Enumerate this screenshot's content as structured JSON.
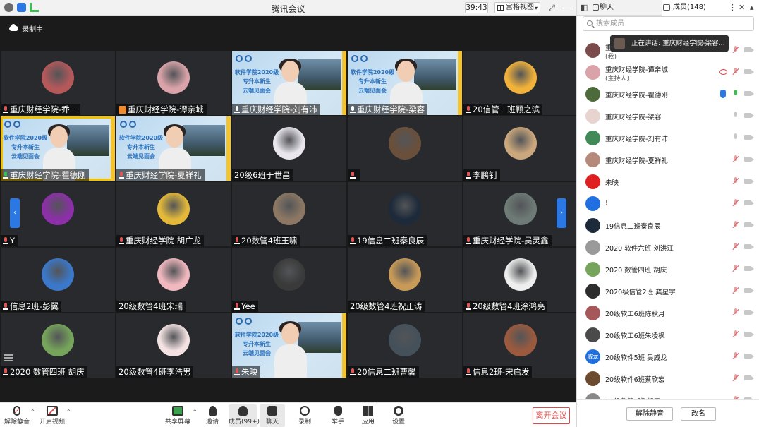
{
  "window": {
    "title": "腾讯会议",
    "timer": "39:43",
    "view_mode": "宫格视图"
  },
  "recording": {
    "label": "录制中"
  },
  "tiles": [
    {
      "name": "重庆财经学院-乔一",
      "mic": "muted",
      "kind": "avatar",
      "color": "#b4585a"
    },
    {
      "name": "重庆财经学院-谭亲城",
      "mic": "user",
      "kind": "avatar",
      "color": "#d9a3a9"
    },
    {
      "name": "重庆财经学院-刘有沛",
      "mic": "on",
      "kind": "slide",
      "active": false
    },
    {
      "name": "重庆财经学院-梁容",
      "mic": "on",
      "kind": "slide",
      "active": false
    },
    {
      "name": "20信管二班顾之滨",
      "mic": "muted",
      "kind": "avatar",
      "color": "#f1b23a"
    },
    {
      "name": "重庆财经学院-瞿德刚",
      "mic": "green",
      "kind": "slide",
      "active": true
    },
    {
      "name": "重庆财经学院-夏祥礼",
      "mic": "muted",
      "kind": "slide",
      "active": false
    },
    {
      "name": "20级6班于世昌",
      "mic": "none",
      "kind": "avatar",
      "color": "#e9e6ee"
    },
    {
      "name": "",
      "mic": "muted",
      "kind": "avatar",
      "color": "#6a4f3a"
    },
    {
      "name": "李鹏钊",
      "mic": "muted",
      "kind": "avatar",
      "color": "#caa77c"
    },
    {
      "name": "Y",
      "mic": "muted",
      "kind": "avatar",
      "color": "#8c2fa8"
    },
    {
      "name": "重庆财经学院 胡广龙",
      "mic": "muted",
      "kind": "avatar",
      "color": "#e4b93a"
    },
    {
      "name": "20数管4班王啸",
      "mic": "muted",
      "kind": "avatar",
      "color": "#8b7763"
    },
    {
      "name": "19信息二班秦良辰",
      "mic": "muted",
      "kind": "avatar",
      "color": "#1d2a3a"
    },
    {
      "name": "重庆财经学院-吴灵鑫",
      "mic": "muted",
      "kind": "avatar",
      "color": "#6d7a75"
    },
    {
      "name": "信息2班-彭翼",
      "mic": "muted",
      "kind": "avatar",
      "color": "#3b78c9"
    },
    {
      "name": "20级数管4班宋瑞",
      "mic": "none",
      "kind": "avatar",
      "color": "#f1b9bf"
    },
    {
      "name": "Yee",
      "mic": "muted",
      "kind": "avatar",
      "color": "#3a3a3a"
    },
    {
      "name": "20级数管4班祝正涛",
      "mic": "none",
      "kind": "avatar",
      "color": "#c89a58"
    },
    {
      "name": "20级数管4班涂鸿亮",
      "mic": "muted",
      "kind": "avatar",
      "color": "#eeeeee"
    },
    {
      "name": "2020 数管四班 胡庆",
      "mic": "muted",
      "kind": "avatar",
      "color": "#76a45a"
    },
    {
      "name": "20级数管4班李浩男",
      "mic": "none",
      "kind": "avatar",
      "color": "#f4e2e3"
    },
    {
      "name": "朱映",
      "mic": "muted",
      "kind": "slide",
      "active": false
    },
    {
      "name": "20信息二班曹馨",
      "mic": "muted",
      "kind": "avatar",
      "color": "#44505a"
    },
    {
      "name": "信息2班-宋启发",
      "mic": "muted",
      "kind": "avatar",
      "color": "#9b5a3e"
    }
  ],
  "slide": {
    "line1": "软件学院2020级",
    "line2": "专升本新生",
    "line3": "云端见面会"
  },
  "toolbar": {
    "unmute": "解除静音",
    "video": "开启视频",
    "share": "共享屏幕",
    "invite": "邀请",
    "members": "成员(99+)",
    "chat": "聊天",
    "record": "录制",
    "hand": "举手",
    "apps": "应用",
    "settings": "设置",
    "leave": "离开会议"
  },
  "panel": {
    "tab_chat": "聊天",
    "tab_members": "成员(148)",
    "search_placeholder": "搜索成员",
    "speaking": "正在讲话: 重庆财经学院-梁容...",
    "unmute_all": "解除静音",
    "rename": "改名",
    "members": [
      {
        "name": "重",
        "sub": "(我)",
        "mic": "muted",
        "color": "#7b4b4b"
      },
      {
        "name": "重庆财经学院-谭亲城",
        "sub": "(主持人)",
        "mic": "muted",
        "rec": true,
        "color": "#d9a3a9"
      },
      {
        "name": "重庆财经学院-瞿德刚",
        "sub": "",
        "mic": "active",
        "hand": true,
        "color": "#4d6a3a"
      },
      {
        "name": "重庆财经学院-梁容",
        "sub": "",
        "mic": "off",
        "color": "#e8d4cf"
      },
      {
        "name": "重庆财经学院-刘有沛",
        "sub": "",
        "mic": "off",
        "color": "#3f8a56"
      },
      {
        "name": "重庆财经学院-夏祥礼",
        "sub": "",
        "mic": "muted",
        "color": "#b58a7a"
      },
      {
        "name": "朱映",
        "sub": "",
        "mic": "muted",
        "color": "#e02020"
      },
      {
        "name": "!",
        "sub": "",
        "mic": "muted",
        "color": "#1f6fe0"
      },
      {
        "name": "19信息二班秦良辰",
        "sub": "",
        "mic": "muted",
        "color": "#1d2a3a"
      },
      {
        "name": "2020 软件六班 刘洪江",
        "sub": "",
        "mic": "muted",
        "color": "#9a9a9a"
      },
      {
        "name": "2020 数管四班 胡庆",
        "sub": "",
        "mic": "muted",
        "color": "#76a45a"
      },
      {
        "name": "2020级信管2班 龚星宇",
        "sub": "",
        "mic": "muted",
        "color": "#2d2d2d"
      },
      {
        "name": "20级软工6班陈秋月",
        "sub": "",
        "mic": "muted",
        "color": "#a5575a"
      },
      {
        "name": "20级软工6班朱凌枫",
        "sub": "",
        "mic": "muted",
        "color": "#4a4a4a"
      },
      {
        "name": "20级软件5班 吴威龙",
        "sub": "",
        "mic": "muted",
        "color": "#1f6fe0",
        "initials": "威龙"
      },
      {
        "name": "20级软件6班蔡欣宏",
        "sub": "",
        "mic": "muted",
        "color": "#6b4a2f"
      },
      {
        "name": "20级数管4班 胡康",
        "sub": "",
        "mic": "muted",
        "color": "#888888"
      }
    ]
  }
}
